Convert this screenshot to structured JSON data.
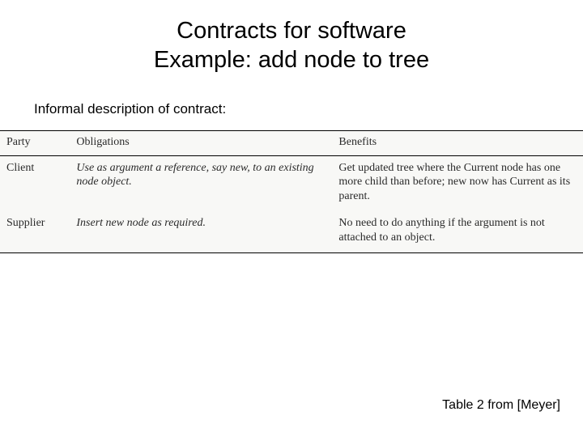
{
  "title_line1": "Contracts for software",
  "title_line2": "Example: add node to tree",
  "subhead": "Informal description of contract:",
  "table": {
    "headers": {
      "party": "Party",
      "obligations": "Obligations",
      "benefits": "Benefits"
    },
    "rows": [
      {
        "party": "Client",
        "obligations": "Use as argument a reference, say new, to an existing  node object.",
        "benefits": "Get updated tree where the Current node has one more child than before; new now has Current as its parent."
      },
      {
        "party": "Supplier",
        "obligations": "Insert new node as required.",
        "benefits": "No need to do anything if the argument is not attached to an object."
      }
    ]
  },
  "caption": "Table 2 from [Meyer]"
}
